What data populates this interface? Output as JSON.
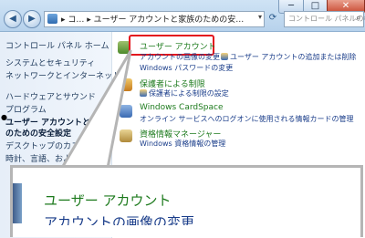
{
  "window": {
    "nav_back": "◀",
    "nav_forward": "▶",
    "address": "▸ コ… ▸ ユーザー アカウントと家族のための安…",
    "search_placeholder": "コントロール パネルの検索",
    "buttons": {
      "minimize": "─",
      "maximize": "□",
      "close": "✕"
    }
  },
  "sidebar": {
    "home": "コントロール パネル ホーム",
    "items": [
      "システムとセキュリティ",
      "ネットワークとインターネット",
      "ハードウェアとサウンド",
      "プログラム",
      "ユーザー アカウントと家族",
      "のための安全設定",
      "デスクトップのカスタマ",
      "時計、言語、および地"
    ]
  },
  "main": {
    "sections": [
      {
        "title": "ユーザー アカウント",
        "links": [
          "アカウントの画像の変更",
          "ユーザー アカウントの追加または削除",
          "Windows パスワードの変更"
        ]
      },
      {
        "title": "保護者による制限",
        "links": [
          "保護者による制限の設定"
        ]
      },
      {
        "title": "Windows CardSpace",
        "links": [
          "オンライン サービスへのログオンに使用される情報カードの管理"
        ]
      },
      {
        "title": "資格情報マネージャー",
        "links": [
          "Windows 資格情報の管理"
        ]
      }
    ]
  },
  "zoom": {
    "title": "ユーザー アカウント",
    "subtitle": "アカウントの画像の変更"
  },
  "colors": {
    "highlight": "#e3141d",
    "category_green": "#1e7b1e",
    "link_blue": "#1a3d8a"
  }
}
